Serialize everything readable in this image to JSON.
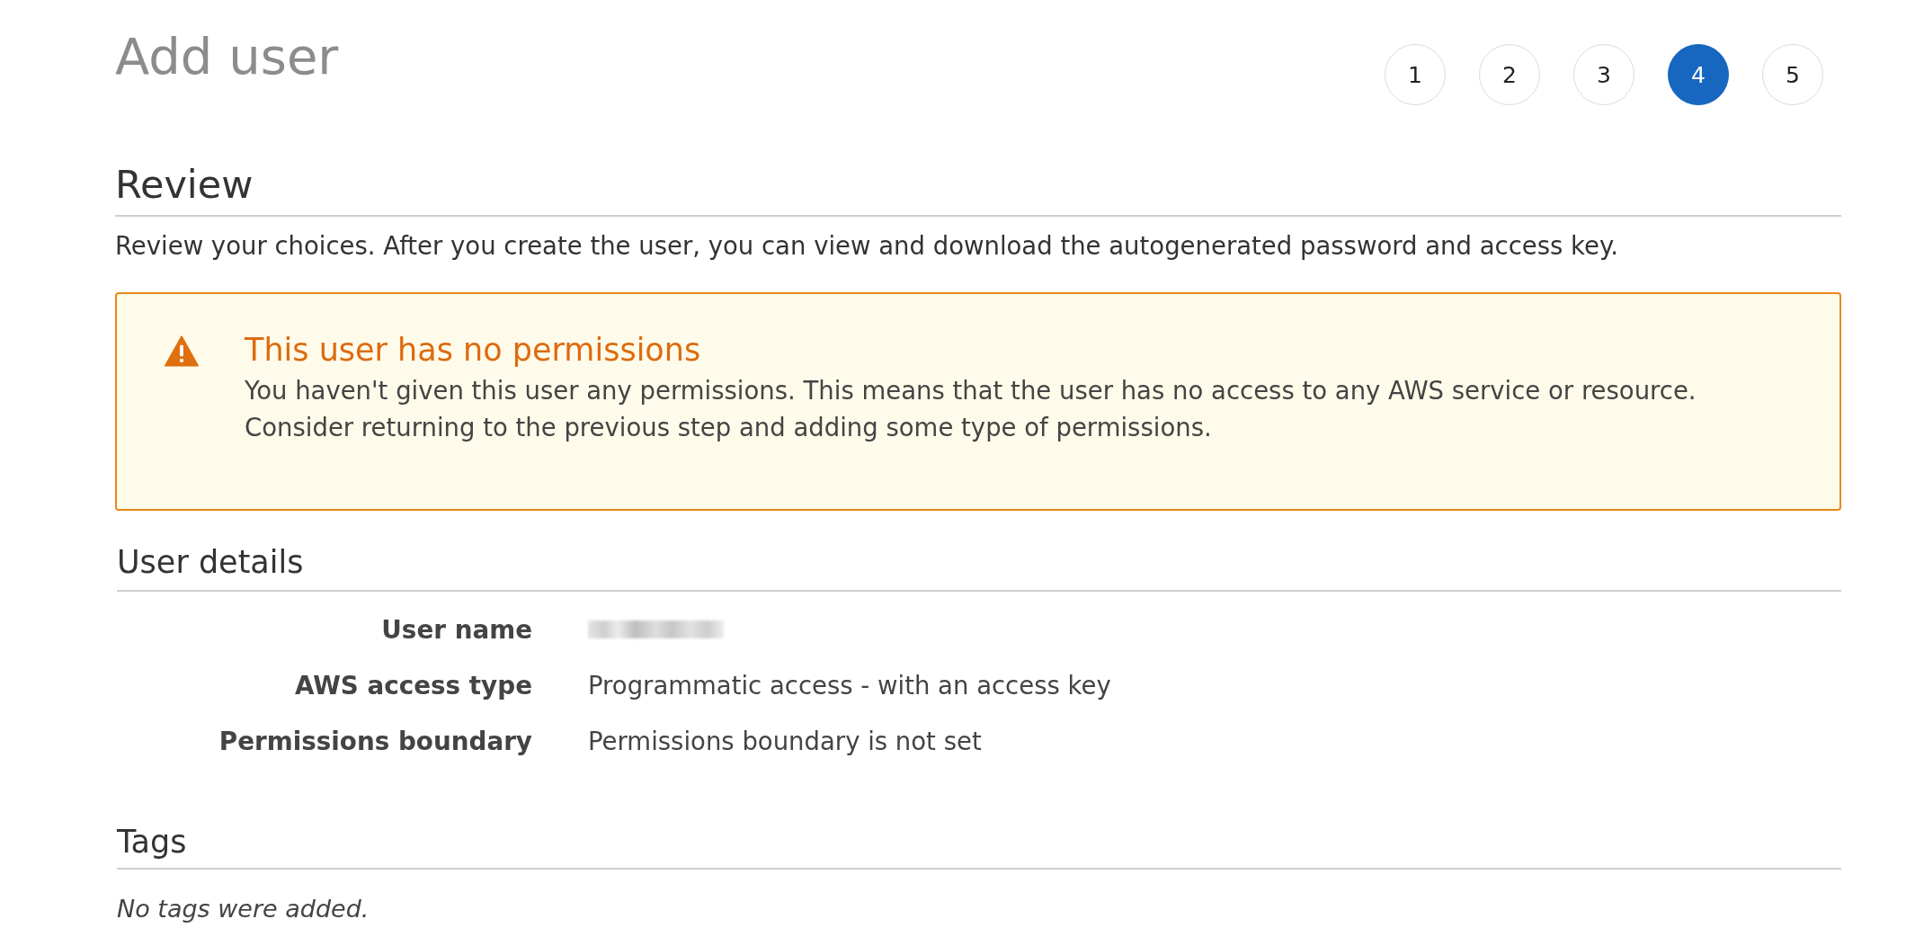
{
  "header": {
    "title": "Add user",
    "steps": [
      {
        "label": "1",
        "selected": false
      },
      {
        "label": "2",
        "selected": false
      },
      {
        "label": "3",
        "selected": false
      },
      {
        "label": "4",
        "selected": true
      },
      {
        "label": "5",
        "selected": false
      }
    ]
  },
  "review": {
    "heading": "Review",
    "description": "Review your choices. After you create the user, you can view and download the autogenerated password and access key."
  },
  "warning": {
    "title": "This user has no permissions",
    "message": "You haven't given this user any permissions. This means that the user has no access to any AWS service or resource. Consider returning to the previous step and adding some type of permissions."
  },
  "user_details": {
    "heading": "User details",
    "rows": [
      {
        "label": "User name",
        "kind": "redacted"
      },
      {
        "label": "AWS access type",
        "kind": "text",
        "value": "Programmatic access - with an access key"
      },
      {
        "label": "Permissions boundary",
        "kind": "text",
        "value": "Permissions boundary is not set"
      }
    ]
  },
  "tags": {
    "heading": "Tags",
    "empty_message": "No tags were added."
  }
}
